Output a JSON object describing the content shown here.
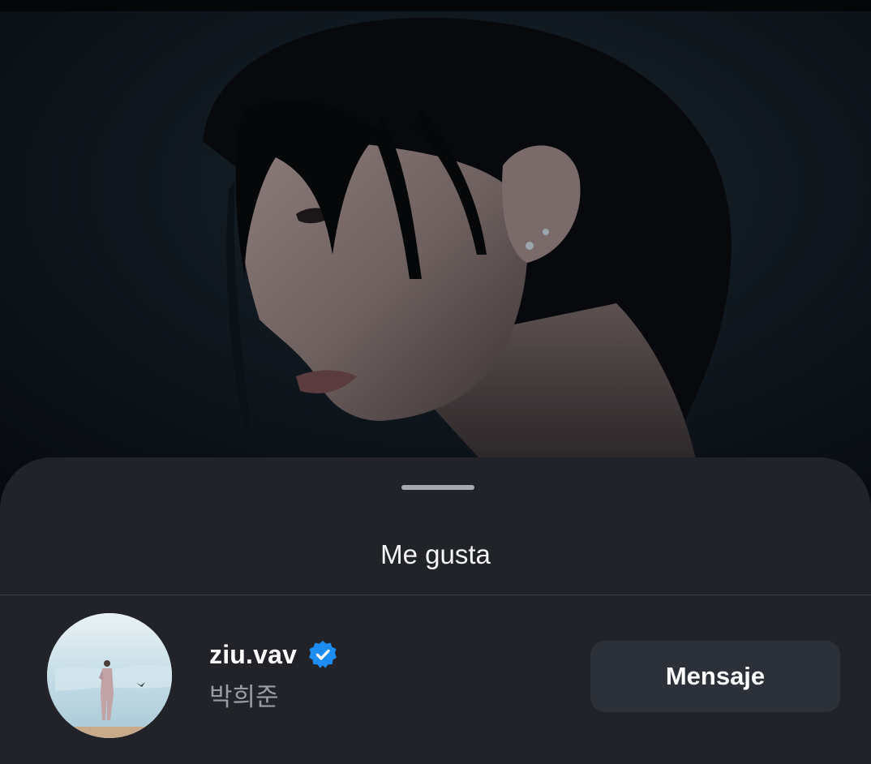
{
  "sheet": {
    "title": "Me gusta"
  },
  "liker": {
    "username": "ziu.vav",
    "full_name": "박희준",
    "verified": true,
    "message_button_label": "Mensaje"
  },
  "icons": {
    "verified": "verified-badge-icon",
    "grabber": "drag-handle-icon"
  },
  "colors": {
    "sheet_background": "#212328",
    "verified_blue": "#1d8cf0",
    "button_background": "#2c3038"
  }
}
